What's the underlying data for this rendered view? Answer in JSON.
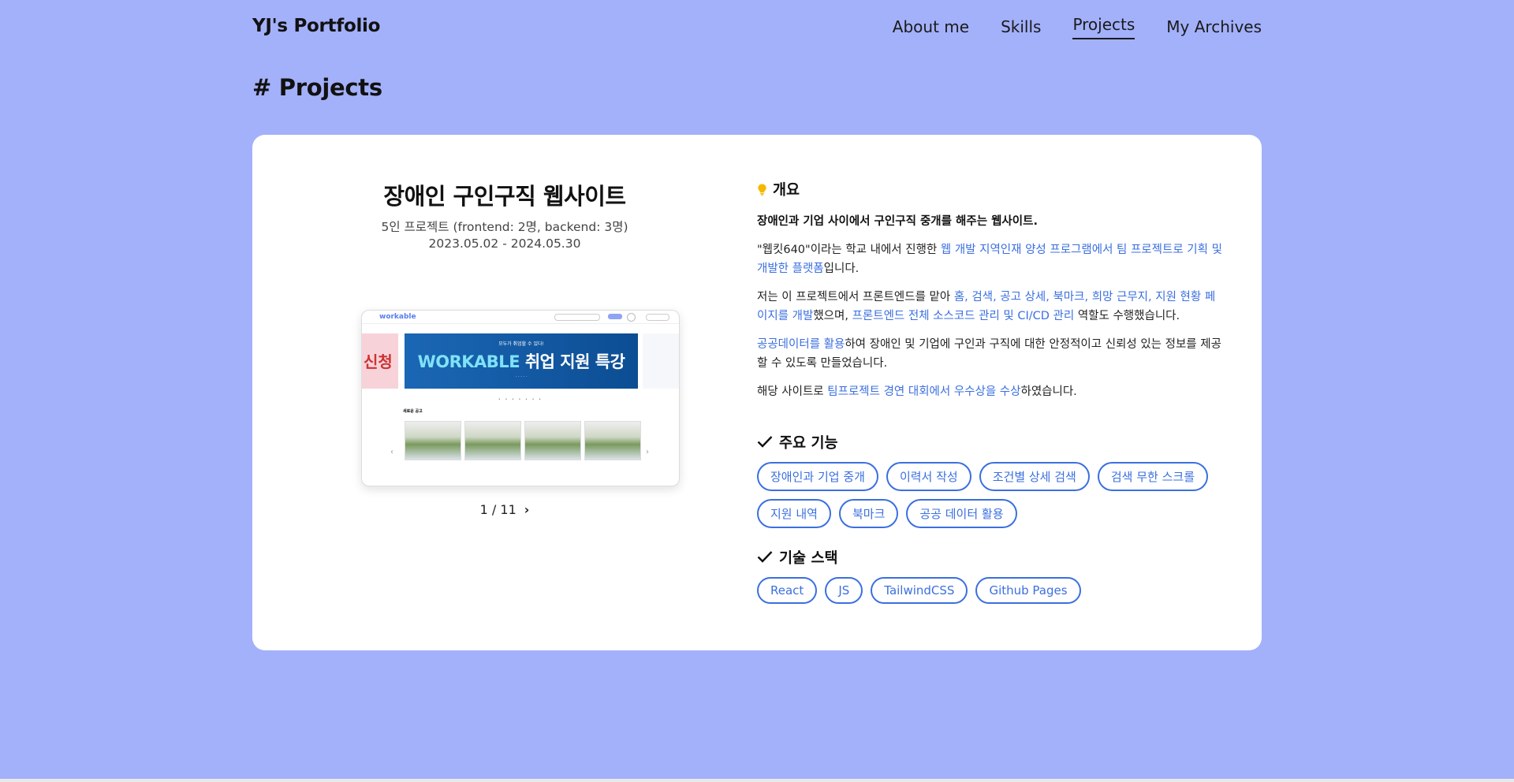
{
  "header": {
    "logo": "YJ's Portfolio",
    "nav": [
      "About me",
      "Skills",
      "Projects",
      "My Archives"
    ],
    "active_nav": "Projects"
  },
  "section_title": "# Projects",
  "project": {
    "title": "장애인 구인구직 웹사이트",
    "subtitle": "5인 프로젝트 (frontend: 2명, backend: 3명)",
    "date": "2023.05.02 - 2024.05.30",
    "screenshot": {
      "logo": "workable",
      "side_text": "신청",
      "banner_top": "모두가 취업할 수 있다!",
      "banner_brand": "WORKABLE",
      "banner_title": "취업 지원 특강",
      "section_label": "새로운 공고"
    },
    "pager": {
      "current": "1",
      "total": "11",
      "text": "1 / 11"
    },
    "overview": {
      "heading": "개요",
      "summary": "장애인과 기업 사이에서 구인구직 중개를 해주는 웹사이트.",
      "p1_a": "\"웹킷640\"이라는 학교 내에서 진행한 ",
      "p1_b": "웹 개발 지역인재 양성 프로그램에서 팀 프로젝트로 기획 및 개발한 플랫폼",
      "p1_c": "입니다.",
      "p2_a": "저는 이 프로젝트에서 프론트엔드를 맡아 ",
      "p2_b": "홈, 검색, 공고 상세, 북마크, 희망 근무지, 지원 현황 페이지를 개발",
      "p2_c": "했으며, ",
      "p2_d": "프론트엔드 전체 소스코드 관리 및 CI/CD 관리",
      "p2_e": " 역할도 수행했습니다.",
      "p3_a": "공공데이터를 활용",
      "p3_b": "하여 장애인 및 기업에 구인과 구직에 대한 안정적이고 신뢰성 있는 정보를 제공할 수 있도록 만들었습니다.",
      "p4_a": "해당 사이트로 ",
      "p4_b": "팀프로젝트 경연 대회에서 우수상을 수상",
      "p4_c": "하였습니다."
    },
    "features": {
      "heading": "주요 기능",
      "items": [
        "장애인과 기업 중개",
        "이력서 작성",
        "조건별 상세 검색",
        "검색 무한 스크롤",
        "지원 내역",
        "북마크",
        "공공 데이터 활용"
      ]
    },
    "stack": {
      "heading": "기술 스택",
      "items": [
        "React",
        "JS",
        "TailwindCSS",
        "Github Pages"
      ]
    }
  },
  "colors": {
    "background": "#a3b1fb",
    "accent": "#3b6fe0",
    "bulb": "#f5b800"
  },
  "icons": {
    "overview": "lightbulb-icon",
    "features": "check-icon",
    "stack": "check-icon",
    "pager_next": "chevron-right-icon"
  }
}
